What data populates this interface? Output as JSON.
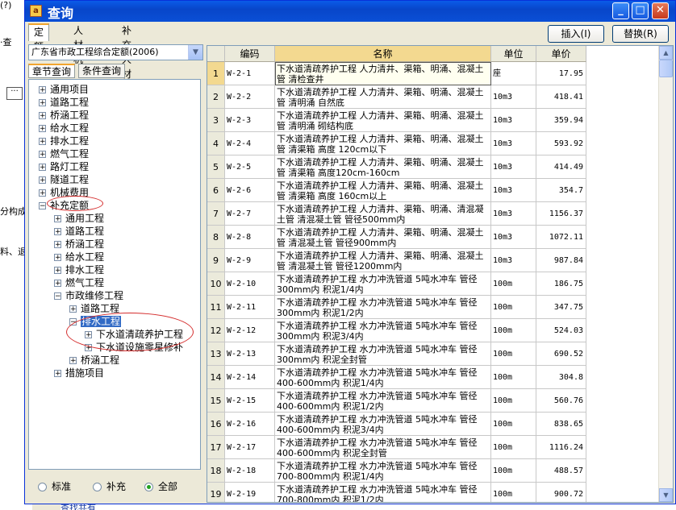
{
  "background": {
    "left_lines": [
      "(?)",
      "·查",
      "分构成",
      "料、退"
    ],
    "bottom_text": "查找共有"
  },
  "window": {
    "title": "查询",
    "icon_letter": "a",
    "buttons": {
      "minimize": "_",
      "maximize": "□",
      "close": "✕"
    }
  },
  "tabs": [
    "定额",
    "人材机",
    "补充人材机"
  ],
  "top_buttons": {
    "insert": "插入(I)",
    "replace": "替换(R)"
  },
  "combo": {
    "value": "广东省市政工程综合定额(2006)"
  },
  "subtabs": [
    "章节查询",
    "条件查询"
  ],
  "tree": [
    {
      "label": "通用项目",
      "level": 0,
      "expander": "+"
    },
    {
      "label": "道路工程",
      "level": 0,
      "expander": "+"
    },
    {
      "label": "桥涵工程",
      "level": 0,
      "expander": "+"
    },
    {
      "label": "给水工程",
      "level": 0,
      "expander": "+"
    },
    {
      "label": "排水工程",
      "level": 0,
      "expander": "+"
    },
    {
      "label": "燃气工程",
      "level": 0,
      "expander": "+"
    },
    {
      "label": "路灯工程",
      "level": 0,
      "expander": "+"
    },
    {
      "label": "隧道工程",
      "level": 0,
      "expander": "+"
    },
    {
      "label": "机械费用",
      "level": 0,
      "expander": "+"
    },
    {
      "label": "补充定额",
      "level": 0,
      "expander": "−"
    },
    {
      "label": "通用工程",
      "level": 1,
      "expander": "+"
    },
    {
      "label": "道路工程",
      "level": 1,
      "expander": "+"
    },
    {
      "label": "桥涵工程",
      "level": 1,
      "expander": "+"
    },
    {
      "label": "给水工程",
      "level": 1,
      "expander": "+"
    },
    {
      "label": "排水工程",
      "level": 1,
      "expander": "+"
    },
    {
      "label": "燃气工程",
      "level": 1,
      "expander": "+"
    },
    {
      "label": "市政维修工程",
      "level": 1,
      "expander": "−"
    },
    {
      "label": "道路工程",
      "level": 2,
      "expander": "+"
    },
    {
      "label": "排水工程",
      "level": 2,
      "expander": "−",
      "selected": true
    },
    {
      "label": "下水道清疏养护工程",
      "level": 3,
      "expander": "+"
    },
    {
      "label": "下水道设施零星修补",
      "level": 3,
      "expander": "+"
    },
    {
      "label": "桥涵工程",
      "level": 2,
      "expander": "+"
    },
    {
      "label": "措施项目",
      "level": 1,
      "expander": "+"
    }
  ],
  "radios": [
    {
      "label": "标准",
      "checked": false
    },
    {
      "label": "补充",
      "checked": false
    },
    {
      "label": "全部",
      "checked": true
    }
  ],
  "grid": {
    "headers": {
      "no": "",
      "code": "编码",
      "name": "名称",
      "unit": "单位",
      "price": "单价"
    },
    "rows": [
      {
        "no": "1",
        "code": "W-2-1",
        "name": "下水道清疏养护工程 人力清井、渠箱、明涌、混凝土管 清检查井",
        "unit": "座",
        "price": "17.95"
      },
      {
        "no": "2",
        "code": "W-2-2",
        "name": "下水道清疏养护工程 人力清井、渠箱、明涌、混凝土管 清明涌 自然底",
        "unit": "10m3",
        "price": "418.41"
      },
      {
        "no": "3",
        "code": "W-2-3",
        "name": "下水道清疏养护工程 人力清井、渠箱、明涌、混凝土管 清明涌 砌结构底",
        "unit": "10m3",
        "price": "359.94"
      },
      {
        "no": "4",
        "code": "W-2-4",
        "name": "下水道清疏养护工程 人力清井、渠箱、明涌、混凝土管 清渠箱 高度 120cm以下",
        "unit": "10m3",
        "price": "593.92"
      },
      {
        "no": "5",
        "code": "W-2-5",
        "name": "下水道清疏养护工程 人力清井、渠箱、明涌、混凝土管 清渠箱 高度120cm-160cm",
        "unit": "10m3",
        "price": "414.49"
      },
      {
        "no": "6",
        "code": "W-2-6",
        "name": "下水道清疏养护工程 人力清井、渠箱、明涌、混凝土管 清渠箱 高度 160cm以上",
        "unit": "10m3",
        "price": "354.7"
      },
      {
        "no": "7",
        "code": "W-2-7",
        "name": "下水道清疏养护工程 人力清井、渠箱、明涌、清混凝土管 清混凝土管 管径500mm内",
        "unit": "10m3",
        "price": "1156.37"
      },
      {
        "no": "8",
        "code": "W-2-8",
        "name": "下水道清疏养护工程 人力清井、渠箱、明涌、混凝土管 清混凝土管 管径900mm内",
        "unit": "10m3",
        "price": "1072.11"
      },
      {
        "no": "9",
        "code": "W-2-9",
        "name": "下水道清疏养护工程 人力清井、渠箱、明涌、混凝土管 清混凝土管 管径1200mm内",
        "unit": "10m3",
        "price": "987.84"
      },
      {
        "no": "10",
        "code": "W-2-10",
        "name": "下水道清疏养护工程 水力冲洗管道 5吨水冲车 管径300mm内 积泥1/4内",
        "unit": "100m",
        "price": "186.75"
      },
      {
        "no": "11",
        "code": "W-2-11",
        "name": "下水道清疏养护工程 水力冲洗管道 5吨水冲车 管径300mm内 积泥1/2内",
        "unit": "100m",
        "price": "347.75"
      },
      {
        "no": "12",
        "code": "W-2-12",
        "name": "下水道清疏养护工程 水力冲洗管道 5吨水冲车 管径300mm内 积泥3/4内",
        "unit": "100m",
        "price": "524.03"
      },
      {
        "no": "13",
        "code": "W-2-13",
        "name": "下水道清疏养护工程 水力冲洗管道 5吨水冲车 管径300mm内 积泥全封管",
        "unit": "100m",
        "price": "690.52"
      },
      {
        "no": "14",
        "code": "W-2-14",
        "name": "下水道清疏养护工程 水力冲洗管道 5吨水冲车 管径400-600mm内 积泥1/4内",
        "unit": "100m",
        "price": "304.8"
      },
      {
        "no": "15",
        "code": "W-2-15",
        "name": "下水道清疏养护工程 水力冲洗管道 5吨水冲车 管径400-600mm内 积泥1/2内",
        "unit": "100m",
        "price": "560.76"
      },
      {
        "no": "16",
        "code": "W-2-16",
        "name": "下水道清疏养护工程 水力冲洗管道 5吨水冲车 管径400-600mm内 积泥3/4内",
        "unit": "100m",
        "price": "838.65"
      },
      {
        "no": "17",
        "code": "W-2-17",
        "name": "下水道清疏养护工程 水力冲洗管道 5吨水冲车 管径400-600mm内 积泥全封管",
        "unit": "100m",
        "price": "1116.24"
      },
      {
        "no": "18",
        "code": "W-2-18",
        "name": "下水道清疏养护工程 水力冲洗管道 5吨水冲车 管径700-800mm内 积泥1/4内",
        "unit": "100m",
        "price": "488.57"
      },
      {
        "no": "19",
        "code": "W-2-19",
        "name": "下水道清疏养护工程 水力冲洗管道 5吨水冲车 管径700-800mm内 积泥1/2内",
        "unit": "100m",
        "price": "900.72"
      }
    ]
  },
  "scrollbar": {
    "up": "▲",
    "down": "▼"
  },
  "colors": {
    "title_bar": "#0846c9",
    "selection": "#316ac5",
    "header_highlight": "#f3d990",
    "annotation": "#d42b2b"
  }
}
